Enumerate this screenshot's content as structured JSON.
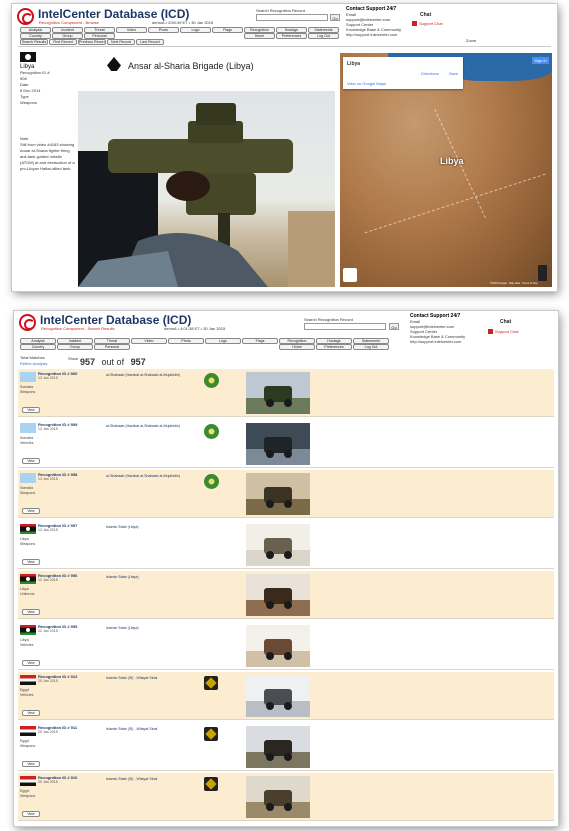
{
  "screen1": {
    "app_title": "IntelCenter Database (ICD)",
    "subtitle": "Recognition Component - Browse",
    "datetime": "demoA • 3:50:39 ET • 30 Jan 2015",
    "search_label": "Search Recognition Record",
    "go_label": "Go",
    "support": {
      "title": "Contact Support 24/7",
      "email_label": "Email",
      "email": "support@intelcenter.com",
      "center": "Support Center",
      "kb": "Knowledge Base & Community",
      "url": "http://support.intelcenter.com"
    },
    "chat_label": "Chat",
    "support_chat": "Support Chat",
    "nav_row1": [
      "Analysis",
      "Incident",
      "Threat",
      "Video",
      "Photo",
      "Logo",
      "Flags",
      "Recognition",
      "Hostage",
      "Statements"
    ],
    "nav_row2": [
      "Country",
      "Group",
      "Personal",
      "",
      "",
      "",
      "",
      "Home",
      "Preferences",
      "Log Out"
    ],
    "nav_row3": [
      "Search Results",
      "First Record",
      "Previous Record",
      "Next Record",
      "Last Record"
    ],
    "zoom_label": "Zoom",
    "record": {
      "country": "Libya",
      "id_label": "Recognition ID #",
      "id": "908",
      "date_label": "Date",
      "date": "8 Dec 2014",
      "type_label": "Type",
      "type": "Weapons",
      "note_label": "Note",
      "note": "Still from video #4183 showing Ansar al-Sharia fighter firing anti-tank guided missile (ATGM) at and destruction of a pro-Libyan Haftar-allied tank."
    },
    "group_name": "Ansar al-Sharia Brigade (Libya)",
    "map": {
      "card_title": "Libya",
      "card_link": "View on Google Maps",
      "directions": "Directions",
      "save": "Save",
      "sign_in": "Sign in",
      "country_label": "Libya",
      "copyright": "©2015 Google · Map data · Terms of Use"
    }
  },
  "screen2": {
    "app_title": "IntelCenter Database (ICD)",
    "subtitle": "Recognition Component - Search Results",
    "datetime": "demoA • 4:01:38 ET • 30 Jan 2015",
    "search_label": "Search Recognition Record",
    "go_label": "Go",
    "support": {
      "title": "Contact Support 24/7",
      "email_label": "Email",
      "email": "support@intelcenter.com",
      "center": "Support Center",
      "kb": "Knowledge Base & Community",
      "url": "http://support.intelcenter.com"
    },
    "chat_label": "Chat",
    "support_chat": "Support Chat",
    "nav_row1": [
      "Analysis",
      "Incident",
      "Threat",
      "Video",
      "Photo",
      "Logo",
      "Flags",
      "Recognition",
      "Hostage",
      "Statements"
    ],
    "nav_row2": [
      "Country",
      "Group",
      "Personal",
      "",
      "",
      "",
      "",
      "Home",
      "Preferences",
      "Log Out"
    ],
    "total_label": "Total Matches",
    "refine_label": "Refine Analysis",
    "show_label": "Show",
    "count": "957",
    "out_of_label": "out of",
    "total": "957",
    "view_label": "View",
    "rows": [
      {
        "id": "Recognition ID # 960",
        "date": "13 Jan 2015",
        "country": "Somalia",
        "type": "Weapons",
        "group": "al-Shabaab (Harakat al-Shabaab al-Mujahidin)",
        "flag": "un",
        "badge": "green"
      },
      {
        "id": "Recognition ID # 959",
        "date": "13 Jan 2015",
        "country": "Somalia",
        "type": "Vehicles",
        "group": "al-Shabaab (Harakat al-Shabaab al-Mujahidin)",
        "flag": "un",
        "badge": "green"
      },
      {
        "id": "Recognition ID # 958",
        "date": "13 Jan 2015",
        "country": "Somalia",
        "type": "Weapons",
        "group": "al-Shabaab (Harakat al-Shabaab al-Mujahidin)",
        "flag": "un",
        "badge": "green"
      },
      {
        "id": "Recognition ID # 957",
        "date": "12 Jan 2015",
        "country": "Libya",
        "type": "Weapons",
        "group": "Islamic State (Libya)",
        "flag": "libya",
        "badge": ""
      },
      {
        "id": "Recognition ID # 956",
        "date": "12 Jan 2015",
        "country": "Libya",
        "type": "Uniforms",
        "group": "Islamic State (Libya)",
        "flag": "libya",
        "badge": ""
      },
      {
        "id": "Recognition ID # 955",
        "date": "12 Jan 2015",
        "country": "Libya",
        "type": "Vehicles",
        "group": "Islamic State (Libya)",
        "flag": "libya",
        "badge": ""
      },
      {
        "id": "Recognition ID # 912",
        "date": "20 Jan 2015",
        "country": "Egypt",
        "type": "Vehicles",
        "group": "Islamic State (IS) - Wilayat Sinai",
        "flag": "egypt",
        "badge": "dark"
      },
      {
        "id": "Recognition ID # 911",
        "date": "20 Jan 2015",
        "country": "Egypt",
        "type": "Weapons",
        "group": "Islamic State (IS) - Wilayat Sinai",
        "flag": "egypt",
        "badge": "dark"
      },
      {
        "id": "Recognition ID # 910",
        "date": "20 Jan 2015",
        "country": "Egypt",
        "type": "Weapons",
        "group": "Islamic State (IS) - Wilayat Sinai",
        "flag": "egypt",
        "badge": "dark"
      }
    ]
  }
}
